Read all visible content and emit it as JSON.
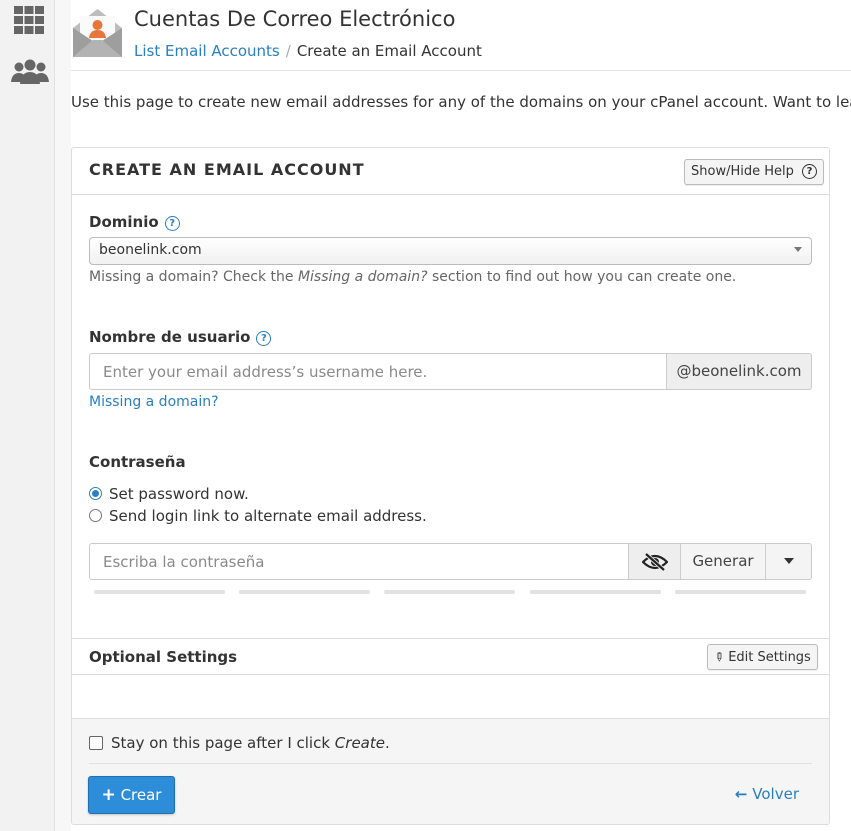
{
  "sidebar": {
    "apps_icon": "grid-icon",
    "users_icon": "users-icon"
  },
  "header": {
    "title": "Cuentas De Correo Electrónico",
    "breadcrumb_link": "List Email Accounts",
    "breadcrumb_separator": "/",
    "breadcrumb_current": "Create an Email Account"
  },
  "intro": "Use this page to create new email addresses for any of the domains on your cPanel account. Want to learn mo",
  "panel": {
    "title": "CREATE AN EMAIL ACCOUNT",
    "help_button": "Show/Hide Help",
    "domain": {
      "label": "Dominio",
      "value": "beonelink.com",
      "hint_prefix": "Missing a domain? Check the ",
      "hint_em": "Missing a domain?",
      "hint_suffix": " section to find out how you can create one."
    },
    "username": {
      "label": "Nombre de usuario",
      "placeholder": "Enter your email address’s username here.",
      "suffix": "@beonelink.com",
      "missing_link": "Missing a domain?"
    },
    "password": {
      "label": "Contraseña",
      "option_now": "Set password now.",
      "option_link": "Send login link to alternate email address.",
      "placeholder": "Escriba la contraseña",
      "generate": "Generar"
    },
    "optional": {
      "label": "Optional Settings",
      "edit_button": "Edit Settings"
    },
    "footer": {
      "stay_prefix": "Stay on this page after I click ",
      "stay_em": "Create",
      "stay_suffix": ".",
      "create_button": "Crear",
      "back_link": "Volver"
    }
  },
  "colors": {
    "accent": "#2a7fc0",
    "primary_button": "#2e8dd8",
    "brand_orange": "#e8753a"
  }
}
